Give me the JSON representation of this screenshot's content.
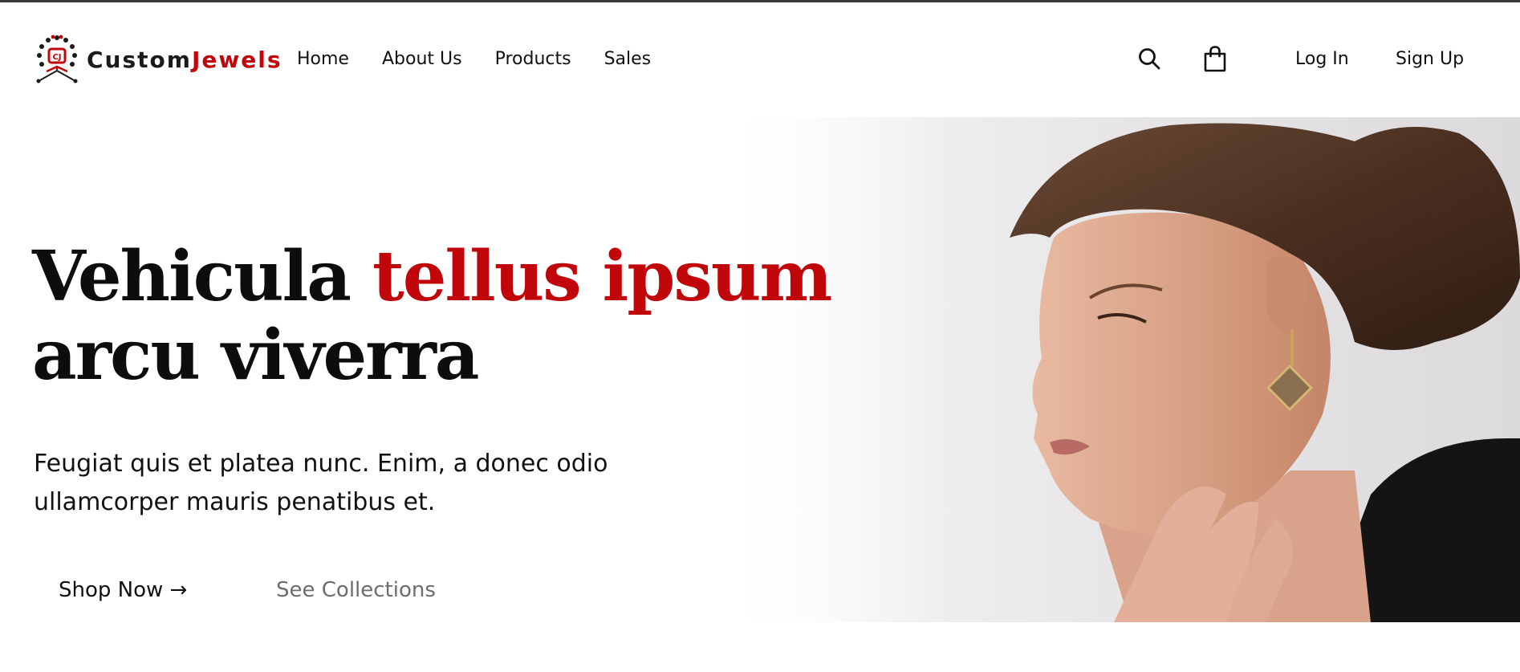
{
  "brand": {
    "name_part1": "Custom",
    "name_part2": "Jewels",
    "logo_initials": "CJ",
    "accent_color": "#c0060b"
  },
  "nav": {
    "items": [
      {
        "label": "Home"
      },
      {
        "label": "About Us"
      },
      {
        "label": "Products"
      },
      {
        "label": "Sales"
      }
    ]
  },
  "header_actions": {
    "search_icon": "search-icon",
    "cart_icon": "shopping-bag-icon",
    "login_label": "Log In",
    "signup_label": "Sign Up"
  },
  "hero": {
    "title_part1": "Vehicula ",
    "title_highlight": "tellus ipsum",
    "title_part2": "arcu viverra",
    "subtitle": "Feugiat quis et platea nunc. Enim, a donec odio ullamcorper mauris penatibus et.",
    "primary_cta": "Shop Now →",
    "secondary_cta": "See Collections",
    "image_subject": "woman-with-earring-photo"
  }
}
